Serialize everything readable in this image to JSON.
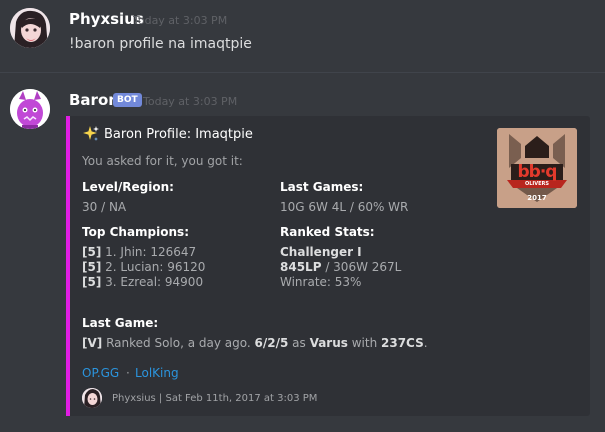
{
  "message1": {
    "username": "Phyxsius",
    "timestamp": "Today at 3:03 PM",
    "text": "!baron profile na imaqtpie"
  },
  "message2": {
    "username": "Baron",
    "bot_tag": "BOT",
    "timestamp": "Today at 3:03 PM",
    "embed": {
      "accent_color": "#e01de3",
      "title_icon": "sparkles-icon",
      "title": "Baron Profile: Imaqtpie",
      "description": "You asked for it, you got it:",
      "fields": {
        "level_region": {
          "name": "Level/Region:",
          "value": "30 / NA"
        },
        "last_games": {
          "name": "Last Games:",
          "value": "10G 6W 4L / 60% WR"
        },
        "top_champions": {
          "name": "Top Champions:",
          "rows": [
            {
              "mastery": "[5]",
              "text": "1. Jhin: 126647"
            },
            {
              "mastery": "[5]",
              "text": "2. Lucian: 96120"
            },
            {
              "mastery": "[5]",
              "text": "3. Ezreal: 94900"
            }
          ]
        },
        "ranked_stats": {
          "name": "Ranked Stats:",
          "tier": "Challenger I",
          "lp": "845LP",
          "record": " / 306W 267L",
          "winrate": "Winrate: 53%"
        },
        "last_game": {
          "name": "Last Game:",
          "tag": "[V]",
          "part1": " Ranked Solo, a day ago. ",
          "kda": "6/2/5",
          "part2": " as ",
          "champion": "Varus",
          "part3": " with ",
          "cs": "237CS",
          "part4": "."
        }
      },
      "links": {
        "opgg": "OP.GG",
        "separator": "·",
        "lolking": "LolKing"
      },
      "footer": "Phyxsius | Sat Feb 11th, 2017 at 3:03 PM",
      "thumbnail": {
        "logo_text": "bb·q",
        "banner": "OLIVERS",
        "year": "2017"
      }
    }
  }
}
